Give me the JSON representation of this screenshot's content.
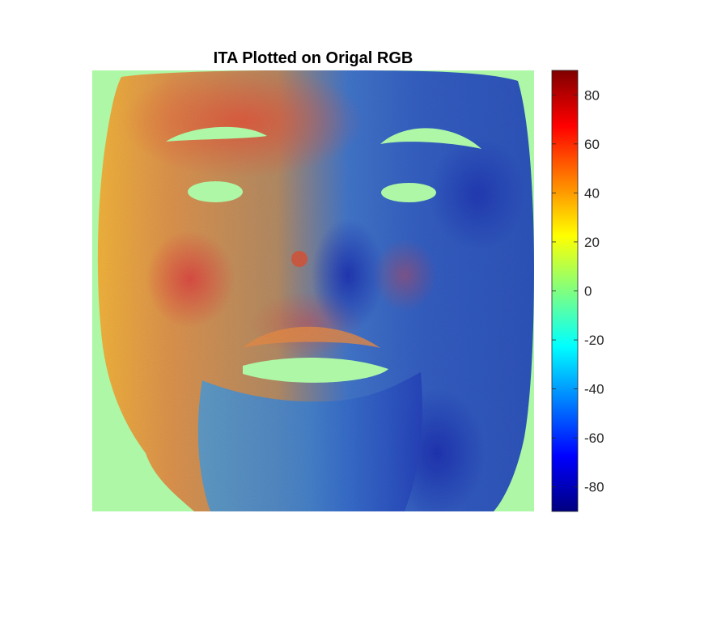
{
  "chart_data": {
    "type": "heatmap",
    "title": "ITA Plotted on Origal RGB",
    "xlabel": "",
    "ylabel": "",
    "colormap": "jet",
    "clim": [
      -90,
      90
    ],
    "colorbar": {
      "ticks": [
        80,
        60,
        40,
        20,
        0,
        -20,
        -40,
        -60,
        -80
      ],
      "tick_labels": [
        "80",
        "60",
        "40",
        "20",
        "0",
        "-20",
        "-40",
        "-60",
        "-80"
      ],
      "placement": "right"
    },
    "background_value": 0,
    "grid": false,
    "content": "face image colored by ITA value; forehead, left cheek and mouth region mostly 20 to 60, right side of face and beard mostly -40 to -80; eyes and mouth openings masked out"
  }
}
